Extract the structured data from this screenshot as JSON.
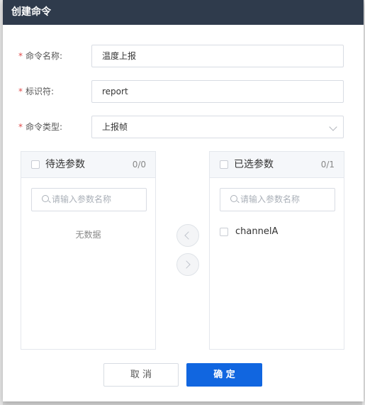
{
  "dialog": {
    "title": "创建命令"
  },
  "form": {
    "name_label": "命令名称:",
    "name_value": "温度上报",
    "id_label": "标识符:",
    "id_value": "report",
    "type_label": "命令类型:",
    "type_value": "上报帧",
    "required_mark": "*"
  },
  "transfer": {
    "left": {
      "title": "待选参数",
      "count": "0/0",
      "search_placeholder": "请输入参数名称",
      "empty_text": "无数据"
    },
    "right": {
      "title": "已选参数",
      "count": "0/1",
      "search_placeholder": "请输入参数名称",
      "items": [
        "channelA"
      ]
    }
  },
  "footer": {
    "cancel_label": "取 消",
    "ok_label": "确 定"
  },
  "colors": {
    "header": "#2f3b4c",
    "primary": "#1166e0",
    "required": "#e04a4a"
  }
}
